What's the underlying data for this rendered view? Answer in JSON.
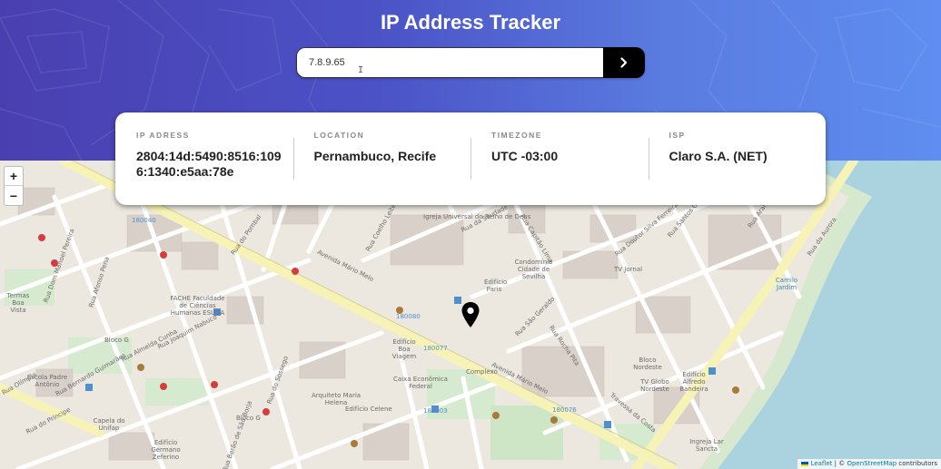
{
  "header": {
    "title": "IP Address Tracker"
  },
  "search": {
    "value": "7.8.9.65",
    "placeholder": "",
    "submit_icon": "chevron-right-icon"
  },
  "info": {
    "ip_label": "IP ADRESS",
    "ip_value": "2804:14d:5490:8516:1096:1340:e5aa:78e",
    "location_label": "LOCATION",
    "location_value": "Pernambuco, Recife",
    "timezone_label": "TIMEZONE",
    "timezone_value": "UTC -03:00",
    "isp_label": "ISP",
    "isp_value": "Claro S.A. (NET)"
  },
  "map": {
    "zoom_in": "+",
    "zoom_out": "−",
    "marker_icon": "location-pin-icon",
    "attribution": {
      "leaflet": "Leaflet",
      "separator": " | © ",
      "osm": "OpenStreetMap",
      "suffix": " contributors"
    },
    "place_labels": [
      "Igreja Universal do Reino de Deus",
      "FACHE Faculdade de Ciências Humanas ESUDA",
      "Edifício Boa Viagem",
      "Complexo",
      "Bloco G",
      "Capela do Unifap",
      "Edifício Germano Zeferino",
      "Caixa Econômica Federal",
      "TV Globo Nordeste",
      "Edifício Alfredo Bandeira",
      "Condomínio Cidade de Sevilha",
      "Edifício Paris",
      "Bloco Nordeste",
      "TV Jornal",
      "Termas Boa Vista",
      "Escola Padre Antônio",
      "Edifício Celene",
      "Bloco G",
      "Arquiteto Maria Helena",
      "Ingreja Lar Sancta",
      "Camilo Jardim",
      "180080",
      "180077",
      "180076",
      "180003",
      "180040"
    ],
    "street_labels": [
      "Avenida Mário Melo",
      "Rua da Saudade",
      "Rua Capitão Lima",
      "Rua Doutor Silva Ferreira",
      "Rua Almeida Cunha",
      "Rua Bernardo Guimarães",
      "Rua do Príncipe",
      "Rua do Sossego",
      "Rua Rocha Pita",
      "Travessa da Costa",
      "Rua da Aurora",
      "Rua Dom Manoel Pereira",
      "Rua Afonso Pena",
      "Rua Olímpia",
      "Rua Barão de São Borja",
      "Rua Coelho Leite",
      "Rua do Pombal",
      "Rua São Geraldo",
      "Rua Joaquim Nabuco",
      "Rua Araripina",
      "Rua Santos Collins"
    ]
  }
}
